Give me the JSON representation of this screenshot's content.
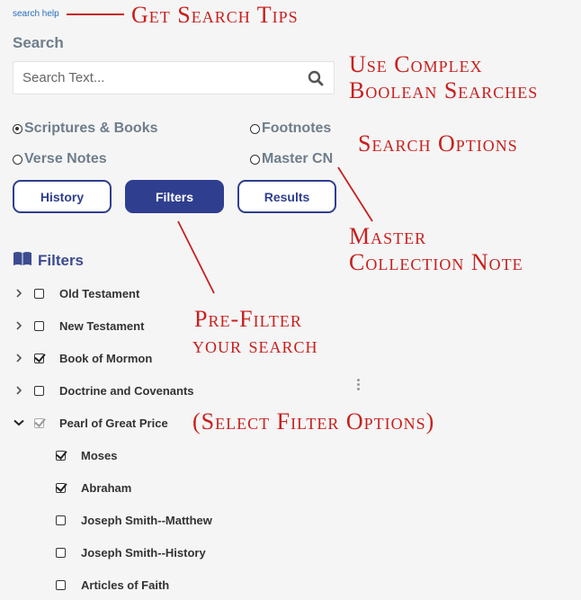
{
  "search_help": "search help",
  "search": {
    "title": "Search",
    "placeholder": "Search Text..."
  },
  "scopes": [
    {
      "label": "Scriptures & Books",
      "selected": true
    },
    {
      "label": "Footnotes",
      "selected": false
    },
    {
      "label": "Verse Notes",
      "selected": false
    },
    {
      "label": "Master CN",
      "selected": false
    }
  ],
  "buttons": {
    "history": "History",
    "filters": "Filters",
    "results": "Results",
    "active": "filters"
  },
  "filters": {
    "heading": "Filters",
    "books": [
      {
        "label": "Old Testament",
        "checked": false,
        "expanded": false
      },
      {
        "label": "New Testament",
        "checked": false,
        "expanded": false
      },
      {
        "label": "Book of Mormon",
        "checked": true,
        "expanded": false
      },
      {
        "label": "Doctrine and Covenants",
        "checked": false,
        "expanded": false
      },
      {
        "label": "Pearl of Great Price",
        "checked": true,
        "expanded": true,
        "partial": true
      }
    ],
    "subbooks": [
      {
        "label": "Moses",
        "checked": true
      },
      {
        "label": "Abraham",
        "checked": true
      },
      {
        "label": "Joseph Smith--Matthew",
        "checked": false
      },
      {
        "label": "Joseph Smith--History",
        "checked": false
      },
      {
        "label": "Articles of Faith",
        "checked": false
      }
    ]
  },
  "annotations": {
    "tips": "Get Search Tips",
    "boolean_1": "Use Complex",
    "boolean_2": "Boolean Searches",
    "options": "Search Options",
    "master_1": "Master",
    "master_2": "Collection Note",
    "prefilter_1": "Pre-Filter",
    "prefilter_2": "your search",
    "select": "(Select Filter Options)"
  },
  "colors": {
    "accent": "#2f3e8f",
    "annotation": "#c8201e",
    "muted_heading": "#6f7d8b"
  }
}
